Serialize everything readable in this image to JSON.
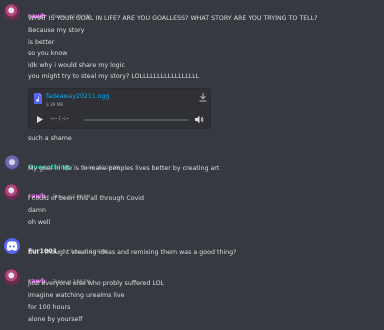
{
  "messages": [
    {
      "author": "rawb",
      "timestamp": "Today at 2:28 PM",
      "lines": [
        "WHAT IS YOUR GOAL IN LIFE? ARE YOU GOALLESS? WHAT STORY ARE YOU TRYING TO TELL?",
        "Because my story",
        "is better",
        "so you know",
        "idk why i would share my logic",
        "you might try to steal my story? LOLLLLLLLLLLLLLLLLL"
      ],
      "attachment": {
        "filename": "fadeaway20211.ogg",
        "size": "3.39 MB",
        "time": "-:-- / -:--"
      },
      "after_lines": [
        "such a shame"
      ]
    },
    {
      "author": "Queenthing",
      "timestamp": "Today at 2:29 PM",
      "lines": [
        "My goal in life is to make peoples lives better by creating art"
      ]
    },
    {
      "author": "rawb",
      "timestamp": "Today at 2:29 PM",
      "lines": [
        "I could of been this all through Covid",
        "damn",
        "oh well"
      ]
    },
    {
      "author": "Fur1001",
      "timestamp": "Today at 2:29 PM",
      "lines": [
        "But I thought stealing ideas and remixing them was a good thing?"
      ]
    },
    {
      "author": "rawb",
      "timestamp": "Today at 2:29 PM",
      "lines": [
        "just everyone else who probly suffered LOL",
        "imagine watching urealms live",
        "for 100 hours",
        "alone by yourself"
      ]
    }
  ],
  "colors": {
    "background": "#36393f",
    "rawb": "#f47fff",
    "queenthing": "#1abc9c",
    "fur1001": "#e3e5e8",
    "link": "#00aff4"
  },
  "icons": {
    "file": "audio-file-icon",
    "download": "download-icon",
    "play": "play-icon",
    "volume": "volume-icon",
    "badge": "server-badge-icon"
  }
}
